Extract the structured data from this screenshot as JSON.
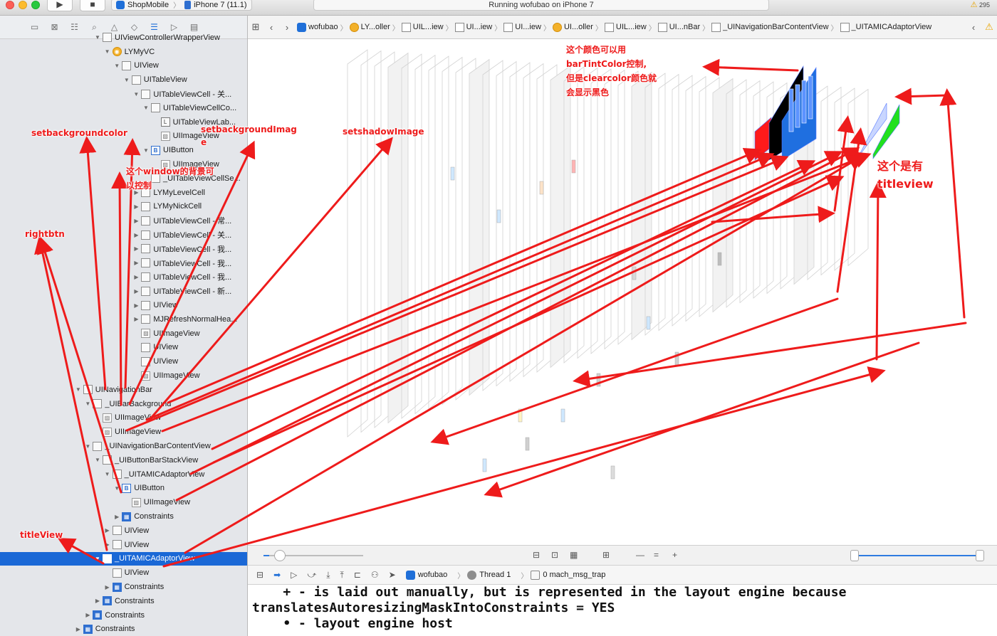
{
  "window": {
    "scheme_target": "ShopMobile",
    "device": "iPhone 7 (11.1)",
    "status": "Running wofubao on iPhone 7",
    "warning_count": "295"
  },
  "navigator": {
    "toolbar_icons": [
      "folder-icon",
      "source-control-icon",
      "hierarchy-icon",
      "search-icon",
      "issue-icon",
      "test-icon",
      "debug-icon",
      "breakpoint-icon",
      "report-icon"
    ],
    "rows": [
      {
        "label": "UIViewControllerWrapperView",
        "depth": 10,
        "icon": "view",
        "disclosure": "open"
      },
      {
        "label": "LYMyVC",
        "depth": 11,
        "icon": "vc",
        "disclosure": "open"
      },
      {
        "label": "UIView",
        "depth": 12,
        "icon": "view",
        "disclosure": "open"
      },
      {
        "label": "UITableView",
        "depth": 13,
        "icon": "view",
        "disclosure": "open"
      },
      {
        "label": "UITableViewCell - 关...",
        "depth": 14,
        "icon": "view",
        "disclosure": "open"
      },
      {
        "label": "UITableViewCellCo...",
        "depth": 15,
        "icon": "view",
        "disclosure": "open"
      },
      {
        "label": "UITableViewLab...",
        "depth": 16,
        "icon": "label",
        "disclosure": "none"
      },
      {
        "label": "UIImageView",
        "depth": 16,
        "icon": "image",
        "disclosure": "none"
      },
      {
        "label": "UIButton",
        "depth": 15,
        "icon": "button",
        "disclosure": "open"
      },
      {
        "label": "UIImageView",
        "depth": 16,
        "icon": "image",
        "disclosure": "none"
      },
      {
        "label": "_UITableViewCellSe...",
        "depth": 15,
        "icon": "view",
        "disclosure": "none"
      },
      {
        "label": "LYMyLevelCell",
        "depth": 14,
        "icon": "view",
        "disclosure": "closed"
      },
      {
        "label": "LYMyNickCell",
        "depth": 14,
        "icon": "view",
        "disclosure": "closed"
      },
      {
        "label": "UITableViewCell - 常...",
        "depth": 14,
        "icon": "view",
        "disclosure": "closed"
      },
      {
        "label": "UITableViewCell - 关...",
        "depth": 14,
        "icon": "view",
        "disclosure": "closed"
      },
      {
        "label": "UITableViewCell - 我...",
        "depth": 14,
        "icon": "view",
        "disclosure": "closed"
      },
      {
        "label": "UITableViewCell - 我...",
        "depth": 14,
        "icon": "view",
        "disclosure": "closed"
      },
      {
        "label": "UITableViewCell - 我...",
        "depth": 14,
        "icon": "view",
        "disclosure": "closed"
      },
      {
        "label": "UITableViewCell - 新...",
        "depth": 14,
        "icon": "view",
        "disclosure": "closed"
      },
      {
        "label": "UIView",
        "depth": 14,
        "icon": "view",
        "disclosure": "closed"
      },
      {
        "label": "MJRefreshNormalHea...",
        "depth": 14,
        "icon": "view",
        "disclosure": "closed"
      },
      {
        "label": "UIImageView",
        "depth": 14,
        "icon": "image",
        "disclosure": "none"
      },
      {
        "label": "UIView",
        "depth": 14,
        "icon": "view",
        "disclosure": "none"
      },
      {
        "label": "UIView",
        "depth": 14,
        "icon": "view",
        "disclosure": "none"
      },
      {
        "label": "UIImageView",
        "depth": 14,
        "icon": "image",
        "disclosure": "none"
      },
      {
        "label": "UINavigationBar",
        "depth": 8,
        "icon": "view",
        "disclosure": "open"
      },
      {
        "label": "_UIBarBackground",
        "depth": 9,
        "icon": "view",
        "disclosure": "open"
      },
      {
        "label": "UIImageView",
        "depth": 10,
        "icon": "image",
        "disclosure": "none"
      },
      {
        "label": "UIImageView",
        "depth": 10,
        "icon": "image",
        "disclosure": "none"
      },
      {
        "label": "_UINavigationBarContentView",
        "depth": 9,
        "icon": "view",
        "disclosure": "open"
      },
      {
        "label": "_UIButtonBarStackView",
        "depth": 10,
        "icon": "view",
        "disclosure": "open"
      },
      {
        "label": "_UITAMICAdaptorView",
        "depth": 11,
        "icon": "view",
        "disclosure": "open"
      },
      {
        "label": "UIButton",
        "depth": 12,
        "icon": "button",
        "disclosure": "open"
      },
      {
        "label": "UIImageView",
        "depth": 13,
        "icon": "image",
        "disclosure": "none"
      },
      {
        "label": "Constraints",
        "depth": 12,
        "icon": "constraints",
        "disclosure": "closed"
      },
      {
        "label": "UIView",
        "depth": 11,
        "icon": "view",
        "disclosure": "closed"
      },
      {
        "label": "UIView",
        "depth": 11,
        "icon": "view",
        "disclosure": "closed"
      },
      {
        "label": "_UITAMICAdaptorView",
        "depth": 10,
        "icon": "view",
        "disclosure": "open",
        "selected": true
      },
      {
        "label": "UIView",
        "depth": 11,
        "icon": "view",
        "disclosure": "none"
      },
      {
        "label": "Constraints",
        "depth": 11,
        "icon": "constraints",
        "disclosure": "closed"
      },
      {
        "label": "Constraints",
        "depth": 10,
        "icon": "constraints",
        "disclosure": "closed"
      },
      {
        "label": "Constraints",
        "depth": 9,
        "icon": "constraints",
        "disclosure": "closed"
      },
      {
        "label": "Constraints",
        "depth": 8,
        "icon": "constraints",
        "disclosure": "closed"
      }
    ]
  },
  "jumpbar": {
    "crumbs": [
      {
        "label": "wofubao",
        "icon": "app"
      },
      {
        "label": "LY...oller",
        "icon": "vc"
      },
      {
        "label": "UIL...iew",
        "icon": "view"
      },
      {
        "label": "UI...iew",
        "icon": "view"
      },
      {
        "label": "UI...iew",
        "icon": "view"
      },
      {
        "label": "UI...oller",
        "icon": "vc"
      },
      {
        "label": "UIL...iew",
        "icon": "view"
      },
      {
        "label": "UI...nBar",
        "icon": "view"
      },
      {
        "label": "_UINavigationBarContentView",
        "icon": "view"
      },
      {
        "label": "_UITAMICAdaptorView",
        "icon": "view"
      }
    ]
  },
  "debug_bar": {
    "process": "wofubao",
    "thread": "Thread 1",
    "frame": "0 mach_msg_trap"
  },
  "console": {
    "lines": [
      "    + - is laid out manually, but is represented in the layout engine because",
      "translatesAutoresizingMaskIntoConstraints = YES",
      "    • - layout engine host"
    ]
  },
  "annotations": {
    "bar_tint": [
      "这个颜色可以用",
      "barTintColor控制,",
      "但是clearcolor颜色就",
      "会显示黑色"
    ],
    "setbackgroundcolor": "setbackgroundcolor",
    "setbackgroundimage": [
      "setbackgroundImag",
      "e"
    ],
    "setshadowimage": "setshadowImage",
    "window_bg": [
      "这个window的背景可",
      "以控制"
    ],
    "rightbtn": "rightbtn",
    "titleview_label": "titleView",
    "has_titleview": [
      "这个是有",
      "titleview"
    ]
  },
  "colors": {
    "annotation_red": "#ee1b1b",
    "selection_blue": "#1a68d6",
    "layer_red": "#ff1a1a",
    "layer_black": "#000000",
    "layer_blue": "#1f6fe0",
    "layer_green": "#22e01e"
  },
  "debug_toolbar": {
    "spacing_slider": 0.06,
    "range_slider": [
      0.0,
      1.0
    ]
  }
}
